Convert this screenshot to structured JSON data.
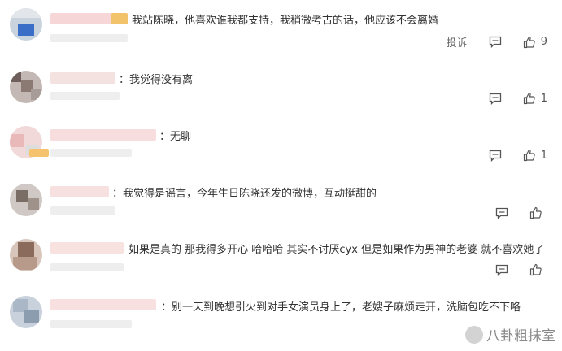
{
  "comments": [
    {
      "text": "我站陈晓，他喜欢谁我都支持，我稍微考古的话，他应该不会离婚",
      "report_label": "投诉",
      "likes": "9"
    },
    {
      "text": "：我觉得没有离",
      "likes": "1"
    },
    {
      "text": "：无聊",
      "likes": "1"
    },
    {
      "text": "：我觉得是谣言，今年生日陈晓还发的微博，互动挺甜的",
      "likes": ""
    },
    {
      "text": "如果是真的 那我得多开心 哈哈哈 其实不讨厌cyx 但是如果作为男神的老婆 就不喜欢她了",
      "likes": ""
    },
    {
      "text": "：别一天到晚想引火到对手女演员身上了，老嫂子麻烦走开，洗脑包吃不下咯",
      "likes": ""
    }
  ],
  "watermark": "八卦粗抹室",
  "icons": {
    "reply": "comment-icon",
    "like": "thumbs-up-icon"
  }
}
